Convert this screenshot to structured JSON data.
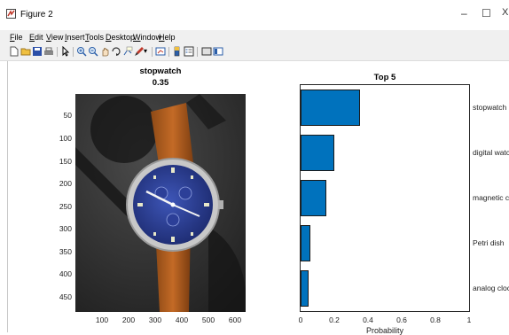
{
  "window": {
    "title": "Figure 2",
    "minimize": "–",
    "maximize": "☐",
    "close": "X"
  },
  "menubar": {
    "items": [
      {
        "label": "File",
        "mnemonic": "F"
      },
      {
        "label": "Edit",
        "mnemonic": "E"
      },
      {
        "label": "View",
        "mnemonic": "V"
      },
      {
        "label": "Insert",
        "mnemonic": "I"
      },
      {
        "label": "Tools",
        "mnemonic": "T"
      },
      {
        "label": "Desktop",
        "mnemonic": "D"
      },
      {
        "label": "Window",
        "mnemonic": "W"
      },
      {
        "label": "Help",
        "mnemonic": "H"
      }
    ]
  },
  "toolbar": {
    "icons": [
      "new-figure-icon",
      "open-file-icon",
      "save-icon",
      "print-icon",
      "select-arrow-icon",
      "zoom-in-icon",
      "zoom-out-icon",
      "pan-icon",
      "rotate-3d-icon",
      "data-cursor-icon",
      "brush-icon",
      "link-plot-icon",
      "colorbar-icon",
      "legend-icon",
      "hide-plot-tools-icon",
      "show-plot-tools-icon"
    ]
  },
  "left_axes": {
    "title_line1": "stopwatch",
    "title_line2": "0.35",
    "yticks": [
      "50",
      "100",
      "150",
      "200",
      "250",
      "300",
      "350",
      "400",
      "450"
    ],
    "xticks": [
      "100",
      "200",
      "300",
      "400",
      "500",
      "600"
    ]
  },
  "chart_data": {
    "type": "bar",
    "orientation": "horizontal",
    "title": "Top 5",
    "xlabel": "Probability",
    "ylabel": "",
    "xlim": [
      0,
      1
    ],
    "xticks": [
      "0",
      "0.2",
      "0.4",
      "0.6",
      "0.8",
      "1"
    ],
    "categories": [
      "stopwatch",
      "digital watch",
      "magnetic com",
      "Petri dish",
      "analog clock"
    ],
    "values": [
      0.35,
      0.2,
      0.15,
      0.06,
      0.045
    ],
    "colors": {
      "bar": "#0072bd"
    }
  }
}
